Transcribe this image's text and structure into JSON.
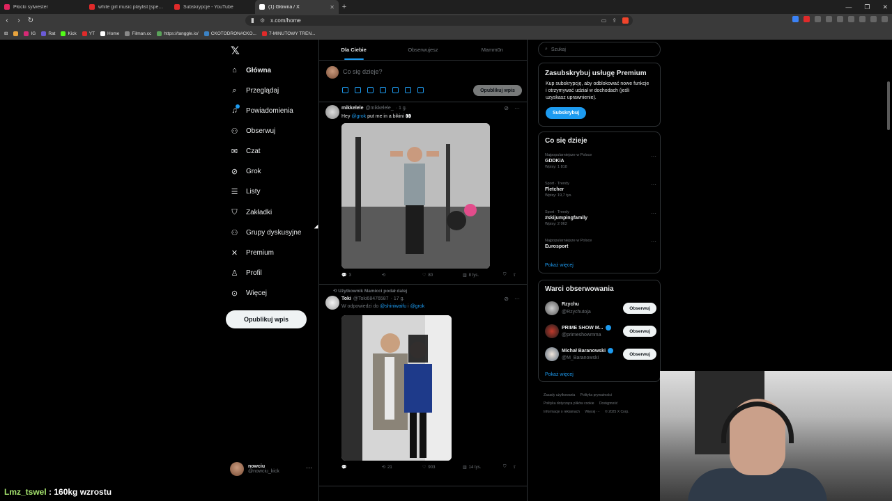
{
  "browser": {
    "tabs": [
      {
        "title": "Płocki sylwester",
        "fav": "#e0245e"
      },
      {
        "title": "white girl music playlist [sped up] - Y",
        "fav": "#e02a2a"
      },
      {
        "title": "Subskrypcje - YouTube",
        "fav": "#e02a2a"
      },
      {
        "title": "(1) Główna / X",
        "fav": "#ffffff",
        "active": true
      }
    ],
    "url": "x.com/home",
    "bookmarks": [
      {
        "label": "IG",
        "fav": "#d62976"
      },
      {
        "label": "Rat",
        "fav": "#6b5bd6"
      },
      {
        "label": "Kick",
        "fav": "#53fc18"
      },
      {
        "label": "YT",
        "fav": "#e02a2a"
      },
      {
        "label": "Home",
        "fav": "#ffffff"
      },
      {
        "label": "Filman.cc",
        "fav": "#888888"
      },
      {
        "label": "https://tanggle.io/",
        "fav": "#5aa35a"
      },
      {
        "label": "CKOTODRON#CKO...",
        "fav": "#3b82c4"
      },
      {
        "label": "7-MINUTOWY TREN...",
        "fav": "#e02a2a"
      }
    ]
  },
  "nav": {
    "items": [
      {
        "label": "Główna",
        "icon": "home-icon",
        "glyph": "⌂"
      },
      {
        "label": "Przeglądaj",
        "icon": "search-icon",
        "glyph": "⌕"
      },
      {
        "label": "Powiadomienia",
        "icon": "bell-icon",
        "glyph": "🔔"
      },
      {
        "label": "Obserwuj",
        "icon": "follow-icon",
        "glyph": "👤"
      },
      {
        "label": "Czat",
        "icon": "mail-icon",
        "glyph": "✉"
      },
      {
        "label": "Grok",
        "icon": "grok-icon",
        "glyph": "⊘"
      },
      {
        "label": "Listy",
        "icon": "list-icon",
        "glyph": "☰"
      },
      {
        "label": "Zakładki",
        "icon": "bookmark-icon",
        "glyph": "🔖"
      },
      {
        "label": "Grupy dyskusyjne",
        "icon": "communities-icon",
        "glyph": "👥"
      },
      {
        "label": "Premium",
        "icon": "x-premium-icon",
        "glyph": "𝕏"
      },
      {
        "label": "Profil",
        "icon": "profile-icon",
        "glyph": "👤"
      },
      {
        "label": "Więcej",
        "icon": "more-icon",
        "glyph": "⋯"
      }
    ],
    "post_button": "Opublikuj wpis",
    "account": {
      "name": "nowciu",
      "handle": "@nowciu_kick"
    }
  },
  "feed": {
    "tabs": [
      "Dla Ciebie",
      "Obserwujesz",
      "Mamm0n"
    ],
    "composer_placeholder": "Co się dzieje?",
    "composer_button": "Opublikuj wpis",
    "tweets": [
      {
        "name": "mikkelele",
        "handle": "@mikkelele_",
        "time": "· 1 g.",
        "text_pre": "Hey ",
        "mention": "@grok",
        "text_post": " put me in a bikini 👀",
        "replies": "3",
        "retweets": "",
        "likes": "80",
        "views": "8 tys."
      },
      {
        "social": "Użytkownik Mamicci podał dalej",
        "name": "Toki",
        "handle": "@Toki68476587",
        "time": "· 17 g.",
        "reply_to": "W odpowiedzi do",
        "mention1": "@shiniwaifu",
        "and": " i ",
        "mention2": "@grok",
        "replies": "",
        "retweets": "21",
        "likes": "903",
        "views": "14 tys."
      }
    ]
  },
  "sidebar": {
    "search_placeholder": "Szukaj",
    "premium": {
      "title": "Zasubskrybuj usługę Premium",
      "text": "Kup subskrypcję, aby odblokować nowe funkcje i otrzymywać udział w dochodach (jeśli uzyskasz uprawnienie).",
      "button": "Subskrybuj"
    },
    "trends_title": "Co się dzieje",
    "trends": [
      {
        "context": "Najpopularniejsze w Polsce",
        "topic": "GDDKiA",
        "count": "Wpisy: 1 818"
      },
      {
        "context": "Sport · Trendy",
        "topic": "Fletcher",
        "count": "Wpisy: 19,7 tys."
      },
      {
        "context": "Sport · Trendy",
        "topic": "#skijumpingfamily",
        "count": "Wpisy: 2 062"
      },
      {
        "context": "Najpopularniejsze w Polsce",
        "topic": "Eurosport",
        "count": ""
      }
    ],
    "show_more": "Pokaż więcej",
    "who_title": "Warci obserwowania",
    "who": [
      {
        "name": "Rzychu",
        "handle": "@Rzychutoja",
        "verified": false,
        "button": "Obserwuj"
      },
      {
        "name": "PRIME SHOW M...",
        "handle": "@primeshowmma",
        "verified": true,
        "button": "Obserwuj"
      },
      {
        "name": "Michał Baranowski",
        "handle": "@M_Baranowski",
        "verified": true,
        "button": "Obserwuj"
      }
    ],
    "who_more": "Pokaż więcej",
    "footer": [
      "Zasady użytkowania",
      "Polityka prywatności",
      "Polityka dotycząca plików cookie",
      "Dostępność",
      "Informacje o reklamach",
      "Więcej ···",
      "© 2025 X Corp."
    ]
  },
  "overlay": {
    "chat_user": "Lmz_tswel",
    "chat_text": " : 160kg wzrostu"
  }
}
